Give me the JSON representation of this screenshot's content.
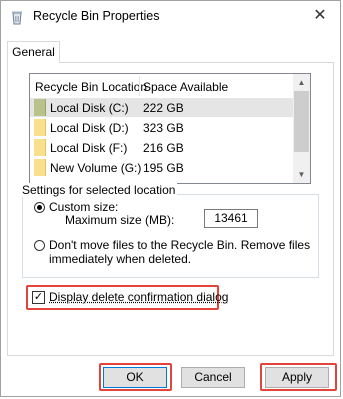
{
  "window": {
    "title": "Recycle Bin Properties",
    "icon": "recycle-bin-icon",
    "close_glyph": "✕"
  },
  "tabs": [
    {
      "label": "General",
      "active": true
    }
  ],
  "list": {
    "columns": [
      "Recycle Bin Location",
      "Space Available"
    ],
    "rows": [
      {
        "name": "Local Disk (C:)",
        "space": "222 GB",
        "selected": true,
        "icon": "folder-icon"
      },
      {
        "name": "Local Disk (D:)",
        "space": "323 GB",
        "selected": false,
        "icon": "folder-icon"
      },
      {
        "name": "Local Disk (F:)",
        "space": "216 GB",
        "selected": false,
        "icon": "folder-icon"
      },
      {
        "name": "New Volume (G:)",
        "space": "195 GB",
        "selected": false,
        "icon": "folder-icon"
      }
    ]
  },
  "settings": {
    "legend": "Settings for selected location",
    "custom_size_label": "Custom size:",
    "max_size_label": "Maximum size (MB):",
    "max_size_value": "13461",
    "dont_move_line1": "Don't move files to the Recycle Bin. Remove files",
    "dont_move_line2": "immediately when deleted.",
    "selected_option": "custom_size"
  },
  "confirm": {
    "label": "Display delete confirmation dialog",
    "checked": true
  },
  "buttons": {
    "ok": "OK",
    "cancel": "Cancel",
    "apply": "Apply"
  },
  "colors": {
    "highlight": "#e0443a",
    "folder": "#f8e08e"
  }
}
